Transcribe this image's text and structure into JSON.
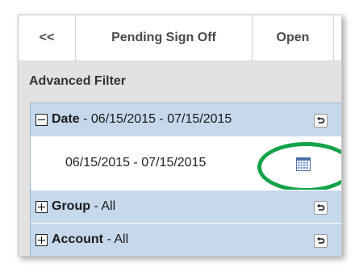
{
  "tabs": {
    "back_label": "<<",
    "pending_label": "Pending Sign Off",
    "open_label": "Open"
  },
  "filter": {
    "title": "Advanced Filter",
    "sections": [
      {
        "name": "Date",
        "value": " - 06/15/2015 - 07/15/2015",
        "state": "expanded",
        "toggle_icon": "minus-icon",
        "reset_icon": "reset-icon"
      },
      {
        "name": "Group",
        "value": " - All",
        "state": "collapsed",
        "toggle_icon": "plus-icon",
        "reset_icon": "reset-icon"
      },
      {
        "name": "Account",
        "value": " - All",
        "state": "collapsed",
        "toggle_icon": "plus-icon",
        "reset_icon": "reset-icon"
      }
    ],
    "date_range_value": "06/15/2015 - 07/15/2015",
    "calendar_icon": "calendar-icon"
  },
  "colors": {
    "panel_bg": "#e2e2e2",
    "section_bg": "#c5d8ec",
    "highlight": "#14a34a"
  }
}
